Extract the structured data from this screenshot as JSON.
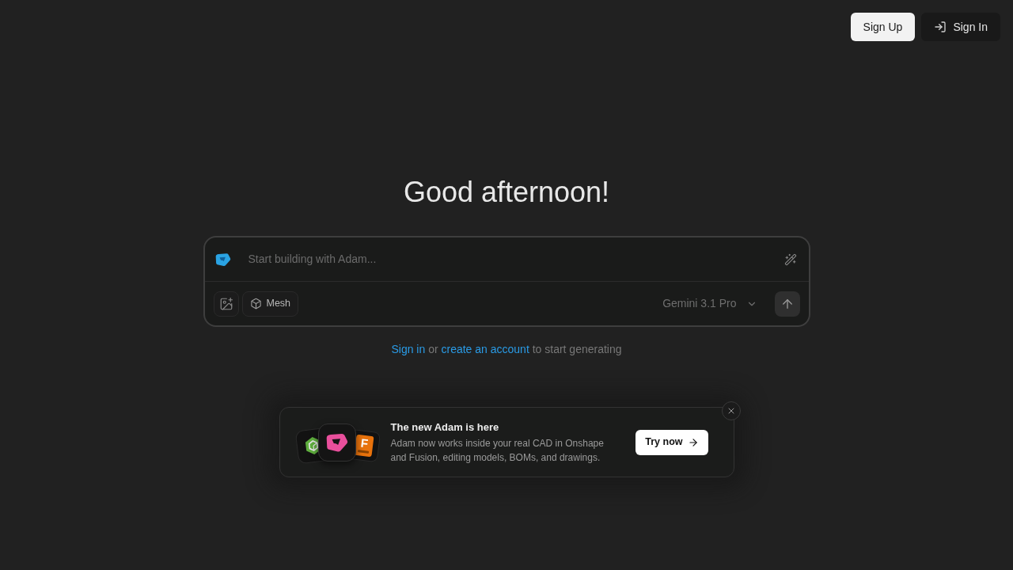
{
  "header": {
    "buttons": [
      {
        "label": "Sign Up",
        "kind": "primary"
      },
      {
        "label": "Sign In",
        "kind": "secondary"
      }
    ]
  },
  "greeting": "Good afternoon!",
  "composer": {
    "placeholder": "Start building with Adam...",
    "chips": [
      {
        "kind": "image"
      },
      {
        "kind": "mesh",
        "label": "Mesh"
      }
    ],
    "model": "Gemini 3.1 Pro"
  },
  "auth_prompt": [
    {
      "kind": "link",
      "text": "Sign in"
    },
    {
      "kind": "plain",
      "text": "or"
    },
    {
      "kind": "link",
      "text": "create an account"
    },
    {
      "kind": "plain",
      "text": "to start generating"
    }
  ],
  "promo": {
    "app_icons": [
      {
        "kind": "hexagon"
      },
      {
        "kind": "adam"
      },
      {
        "kind": "letter",
        "letter": "F"
      }
    ],
    "title": "The new Adam is here",
    "description": "Adam now works inside your real CAD in Onshape and Fusion, editing models, BOMs, and drawings.",
    "button": "Try now"
  }
}
